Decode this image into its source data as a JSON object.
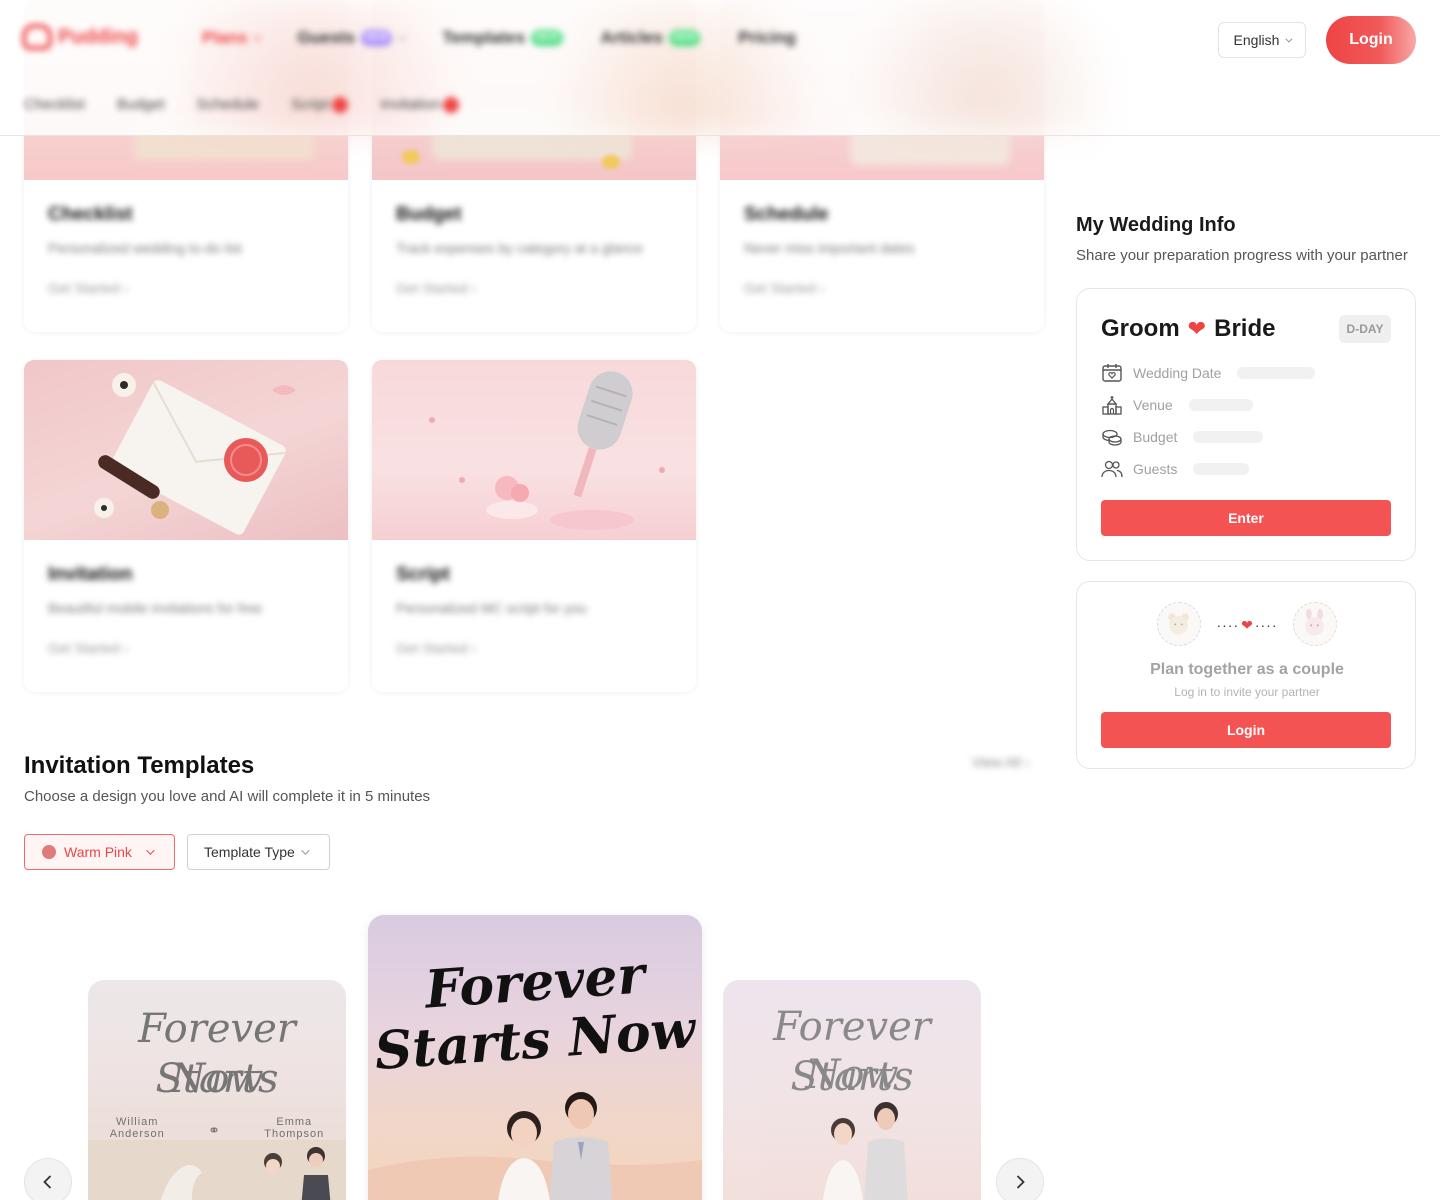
{
  "header": {
    "logo_text": "Pudding",
    "nav": [
      {
        "label": "Plans",
        "active": true
      },
      {
        "label": "Guests",
        "badge": "NEW"
      },
      {
        "label": "Templates",
        "badge": "NEW"
      },
      {
        "label": "Articles",
        "badge": "NEW"
      },
      {
        "label": "Pricing"
      }
    ],
    "subnav": [
      "Checklist",
      "Budget",
      "Schedule",
      "Script",
      "Invitation"
    ],
    "language": "English",
    "login_label": "Login"
  },
  "features": [
    {
      "title": "Checklist",
      "desc": "Personalized wedding to-do list",
      "cta": "Get Started"
    },
    {
      "title": "Budget",
      "desc": "Track expenses by category at a glance",
      "cta": "Get Started"
    },
    {
      "title": "Schedule",
      "desc": "Never miss important dates",
      "cta": "Get Started"
    },
    {
      "title": "Invitation",
      "desc": "Beautiful mobile invitations for free",
      "cta": "Get Started"
    },
    {
      "title": "Script",
      "desc": "Personalized MC script for you",
      "cta": "Get Started"
    }
  ],
  "wedding_info": {
    "title": "My Wedding Info",
    "subtitle": "Share your preparation progress with your partner",
    "groom": "Groom",
    "bride": "Bride",
    "heart": "❤",
    "dday": "D-DAY",
    "rows": [
      {
        "icon": "calendar-heart-icon",
        "label": "Wedding Date"
      },
      {
        "icon": "venue-building-icon",
        "label": "Venue"
      },
      {
        "icon": "coins-icon",
        "label": "Budget"
      },
      {
        "icon": "people-icon",
        "label": "Guests"
      }
    ],
    "enter_label": "Enter"
  },
  "couple": {
    "title": "Plan together as a couple",
    "subtitle": "Log in to invite your partner",
    "login_label": "Login"
  },
  "templates": {
    "title": "Invitation Templates",
    "subtitle": "Choose a design you love and AI will complete it in 5 minutes",
    "view_all": "View All",
    "color_filter": "Warm Pink",
    "type_filter": "Template Type",
    "cards": [
      {
        "script_line1": "Forever Starts",
        "script_line2": "Now",
        "groom_first": "William",
        "groom_last": "Anderson",
        "bride_first": "Emma",
        "bride_last": "Thompson"
      },
      {
        "script_line1": "Forever",
        "script_line2": "Starts Now"
      },
      {
        "script_line1": "Forever Starts",
        "script_line2": "Now"
      }
    ]
  },
  "colors": {
    "accent": "#ef4444",
    "button": "#f45353"
  }
}
